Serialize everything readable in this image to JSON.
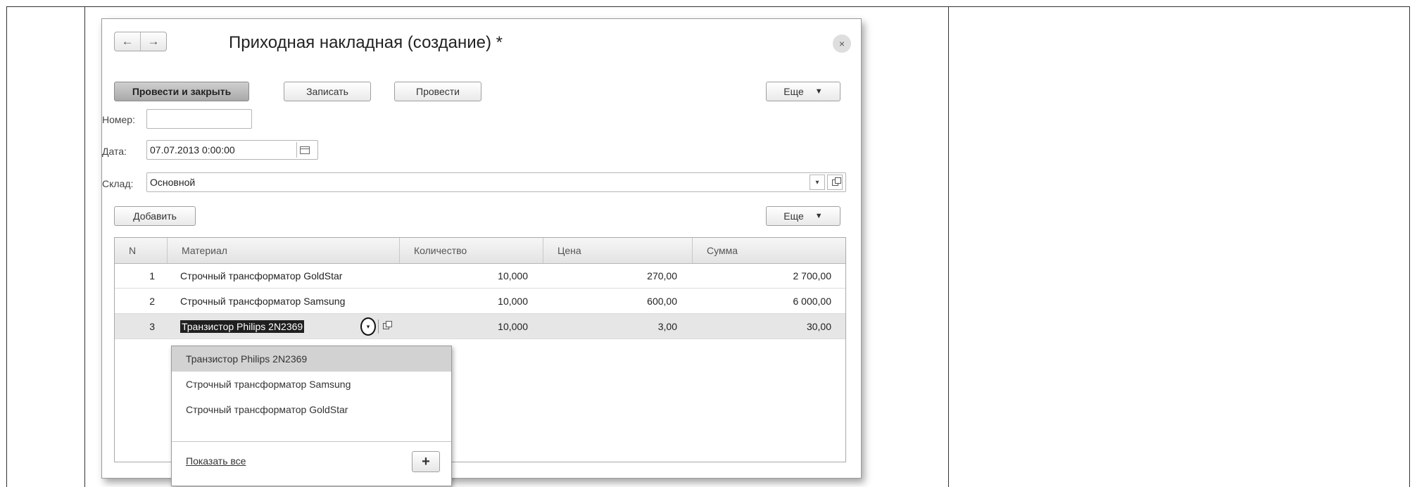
{
  "window": {
    "title": "Приходная накладная (создание) *",
    "nav_back": "←",
    "nav_forward": "→",
    "close": "×"
  },
  "toolbar": {
    "post_close_label": "Провести и закрыть",
    "save_label": "Записать",
    "post_label": "Провести",
    "more_label": "Еще",
    "more_caret": "▼"
  },
  "form": {
    "number_label": "Номер:",
    "number_value": "",
    "date_label": "Дата:",
    "date_value": "07.07.2013  0:00:00",
    "warehouse_label": "Склад:",
    "warehouse_value": "Основной",
    "dropdown_caret": "▾"
  },
  "table_toolbar": {
    "add_label": "Добавить",
    "more_label": "Еще",
    "more_caret": "▼"
  },
  "table": {
    "columns": [
      "N",
      "Материал",
      "Количество",
      "Цена",
      "Сумма"
    ],
    "rows": [
      {
        "n": "1",
        "material": "Строчный трансформатор GoldStar",
        "qty": "10,000",
        "price": "270,00",
        "sum": "2 700,00"
      },
      {
        "n": "2",
        "material": "Строчный трансформатор Samsung",
        "qty": "10,000",
        "price": "600,00",
        "sum": "6 000,00"
      },
      {
        "n": "3",
        "material": "Транзистор Philips 2N2369",
        "qty": "10,000",
        "price": "3,00",
        "sum": "30,00"
      }
    ]
  },
  "dropdown": {
    "items": [
      "Транзистор Philips 2N2369",
      "Строчный трансформатор Samsung",
      "Строчный трансформатор GoldStar"
    ],
    "show_all": "Показать все",
    "add": "+"
  }
}
